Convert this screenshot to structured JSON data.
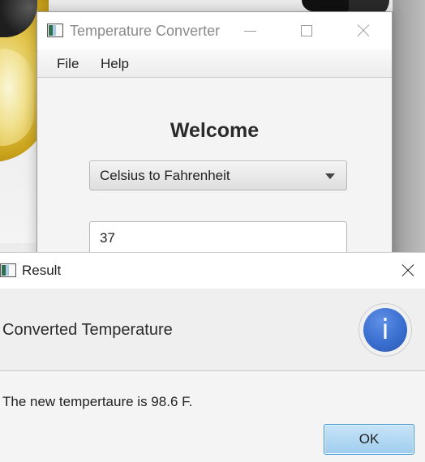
{
  "main_window": {
    "title": "Temperature Converter",
    "menu": [
      "File",
      "Help"
    ],
    "heading": "Welcome",
    "conversion_selected": "Celsius to Fahrenheit",
    "temperature_value": "37"
  },
  "result_dialog": {
    "title": "Result",
    "header": "Converted Temperature",
    "message": "The new tempertaure is 98.6 F.",
    "info_glyph": "i",
    "ok_label": "OK"
  },
  "colors": {
    "accent": "#3b93d4",
    "info_icon": "#3a6fd0"
  },
  "icons": [
    "app-icon",
    "minimize-icon",
    "maximize-icon",
    "close-icon",
    "dropdown-arrow-icon",
    "info-icon"
  ]
}
